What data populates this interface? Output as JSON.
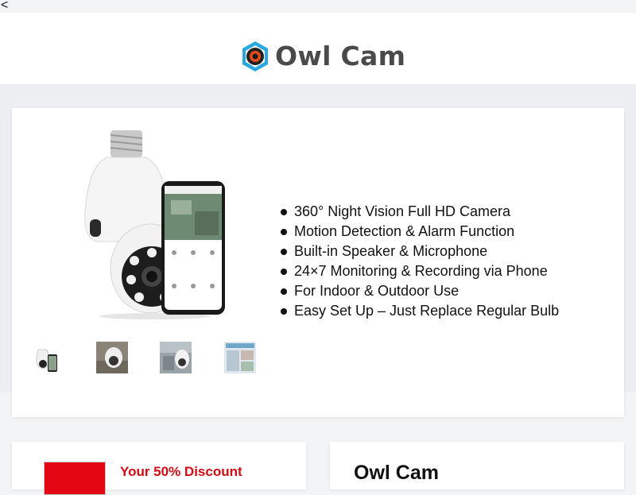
{
  "nav": {
    "back_label": "<"
  },
  "header": {
    "brand_name": "Owl Cam"
  },
  "product": {
    "features": [
      "360° Night Vision Full HD Camera",
      "Motion Detection & Alarm Function",
      "Built-in Speaker & Microphone",
      "24×7 Monitoring & Recording via Phone",
      "For Indoor & Outdoor Use",
      "Easy Set Up – Just Replace Regular Bulb"
    ],
    "thumbnail_count": 4
  },
  "promo": {
    "headline": "Your 50% Discount"
  },
  "info": {
    "title": "Owl Cam"
  },
  "colors": {
    "brand_blue": "#29a8e0",
    "promo_red": "#e30613",
    "logo_text": "#4a4a4a"
  }
}
